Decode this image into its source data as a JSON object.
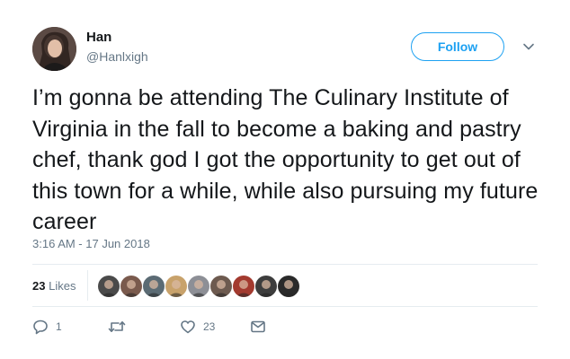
{
  "author": {
    "name": "Han",
    "handle": "@Hanlxigh"
  },
  "follow_label": "Follow",
  "tweet_text": "I’m gonna be attending The Culinary Institute of Virginia in the fall to become a baking and pastry chef, thank god I got the opportunity to get out of this town for a while, while also pursuing my future career",
  "timestamp": "3:16 AM - 17 Jun 2018",
  "likes": {
    "count": "23",
    "label": "Likes"
  },
  "actions": {
    "reply_count": "1",
    "retweet_count": "",
    "like_count": "23"
  },
  "colors": {
    "accent": "#1da1f2",
    "muted": "#657786",
    "text": "#14171a",
    "divider": "#e6ecf0"
  },
  "liker_avatar_colors": [
    "#4a4a4a",
    "#7a5a4d",
    "#5b6b74",
    "#c8a26b",
    "#8d8f96",
    "#6d5a4f",
    "#a33a2f",
    "#3d3d3d",
    "#2a2a2a"
  ]
}
